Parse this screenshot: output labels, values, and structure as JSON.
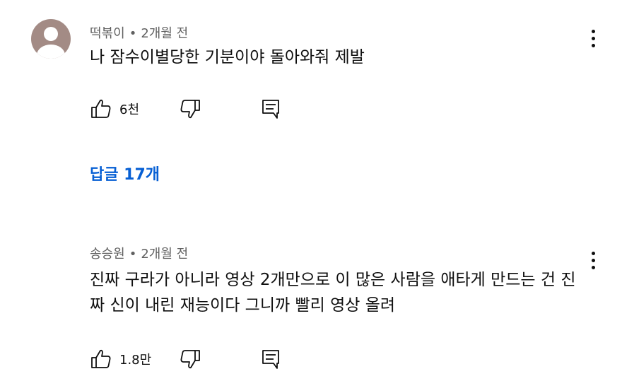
{
  "comments": [
    {
      "author": "떡볶이",
      "separator": "•",
      "time": "2개월 전",
      "text": "나 잠수이별당한 기분이야 돌아와줘 제발",
      "like_count": "6천",
      "replies_label": "답글 17개",
      "avatar_color": "#a38b85"
    },
    {
      "author": "송승원",
      "separator": "•",
      "time": "2개월 전",
      "text": "진짜 구라가 아니라 영상 2개만으로 이 많은 사람을 애타게 만드는 건 진짜 신이 내린 재능이다 그니까 빨리 영상 올려",
      "like_count": "1.8만"
    }
  ],
  "icons": {
    "like": "thumbs-up-icon",
    "dislike": "thumbs-down-icon",
    "reply": "comment-reply-icon",
    "menu": "more-vertical-icon"
  },
  "colors": {
    "replies_link": "#065fd4",
    "meta_text": "#606060",
    "body_text": "#0f0f0f"
  }
}
